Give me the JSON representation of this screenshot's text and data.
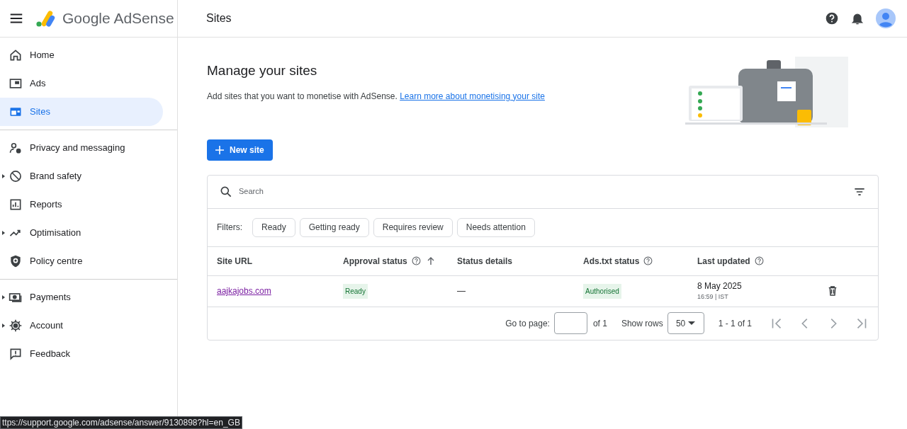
{
  "header": {
    "product": "Google AdSense",
    "page_title": "Sites"
  },
  "sidebar": {
    "sections": [
      [
        {
          "label": "Home",
          "selected": false,
          "kind": "link"
        },
        {
          "label": "Ads",
          "selected": false,
          "kind": "link"
        },
        {
          "label": "Sites",
          "selected": true,
          "kind": "link"
        }
      ],
      [
        {
          "label": "Privacy and messaging",
          "selected": false,
          "kind": "link"
        },
        {
          "label": "Brand safety",
          "selected": false,
          "kind": "group"
        },
        {
          "label": "Reports",
          "selected": false,
          "kind": "link"
        },
        {
          "label": "Optimisation",
          "selected": false,
          "kind": "group"
        },
        {
          "label": "Policy centre",
          "selected": false,
          "kind": "link"
        }
      ],
      [
        {
          "label": "Payments",
          "selected": false,
          "kind": "group"
        },
        {
          "label": "Account",
          "selected": false,
          "kind": "group"
        },
        {
          "label": "Feedback",
          "selected": false,
          "kind": "link"
        }
      ]
    ]
  },
  "main": {
    "title": "Manage your sites",
    "description": "Add sites that you want to monetise with AdSense.",
    "link": "Learn more about monetising your site",
    "new_button": "New site"
  },
  "table": {
    "search": {
      "placeholder": "Search"
    },
    "filters_label": "Filters:",
    "filters": [
      "Ready",
      "Getting ready",
      "Requires review",
      "Needs attention"
    ],
    "columns": [
      {
        "label": "Site URL",
        "help": false,
        "sorted": false
      },
      {
        "label": "Approval status",
        "help": true,
        "sorted": true
      },
      {
        "label": "Status details",
        "help": false,
        "sorted": false
      },
      {
        "label": "Ads.txt status",
        "help": true,
        "sorted": false
      },
      {
        "label": "Last updated",
        "help": true,
        "sorted": false
      }
    ],
    "rows": [
      {
        "site": "aajkajobs.com",
        "approval": "Ready",
        "details": "—",
        "ads_txt": "Authorised",
        "date": "8 May 2025",
        "time": "16:59 | IST"
      }
    ],
    "pagination": {
      "go_to_label": "Go to page:",
      "of_pages": "of 1",
      "show_rows_label": "Show rows",
      "rows_value": "50",
      "range": "1 - 1 of 1"
    }
  },
  "status_bar": {
    "url": "ttps://support.google.com/adsense/answer/9130898?hl=en_GB"
  }
}
